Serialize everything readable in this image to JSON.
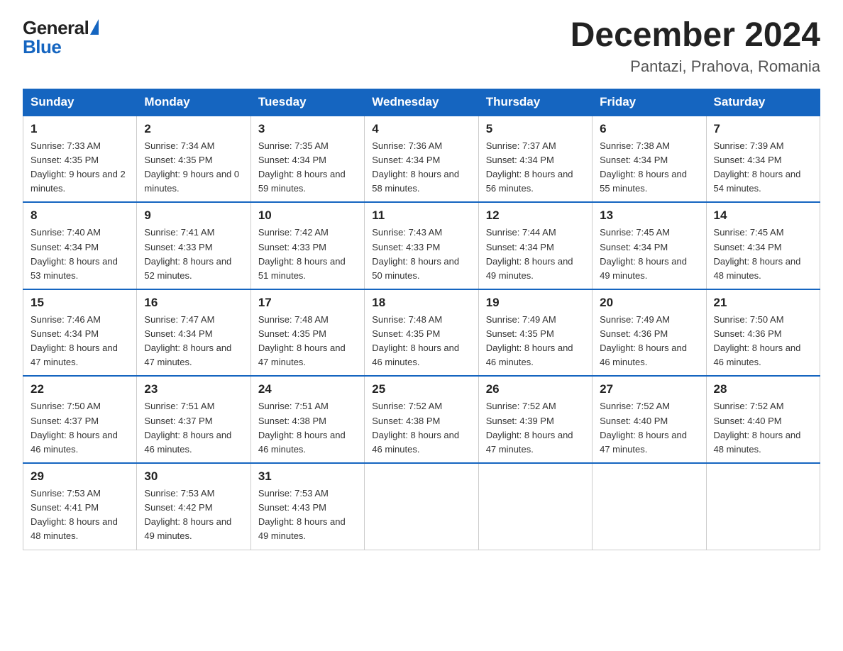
{
  "logo": {
    "general": "General",
    "blue": "Blue"
  },
  "header": {
    "month_year": "December 2024",
    "location": "Pantazi, Prahova, Romania"
  },
  "days_of_week": [
    "Sunday",
    "Monday",
    "Tuesday",
    "Wednesday",
    "Thursday",
    "Friday",
    "Saturday"
  ],
  "weeks": [
    [
      {
        "day": "1",
        "sunrise": "7:33 AM",
        "sunset": "4:35 PM",
        "daylight": "9 hours and 2 minutes."
      },
      {
        "day": "2",
        "sunrise": "7:34 AM",
        "sunset": "4:35 PM",
        "daylight": "9 hours and 0 minutes."
      },
      {
        "day": "3",
        "sunrise": "7:35 AM",
        "sunset": "4:34 PM",
        "daylight": "8 hours and 59 minutes."
      },
      {
        "day": "4",
        "sunrise": "7:36 AM",
        "sunset": "4:34 PM",
        "daylight": "8 hours and 58 minutes."
      },
      {
        "day": "5",
        "sunrise": "7:37 AM",
        "sunset": "4:34 PM",
        "daylight": "8 hours and 56 minutes."
      },
      {
        "day": "6",
        "sunrise": "7:38 AM",
        "sunset": "4:34 PM",
        "daylight": "8 hours and 55 minutes."
      },
      {
        "day": "7",
        "sunrise": "7:39 AM",
        "sunset": "4:34 PM",
        "daylight": "8 hours and 54 minutes."
      }
    ],
    [
      {
        "day": "8",
        "sunrise": "7:40 AM",
        "sunset": "4:34 PM",
        "daylight": "8 hours and 53 minutes."
      },
      {
        "day": "9",
        "sunrise": "7:41 AM",
        "sunset": "4:33 PM",
        "daylight": "8 hours and 52 minutes."
      },
      {
        "day": "10",
        "sunrise": "7:42 AM",
        "sunset": "4:33 PM",
        "daylight": "8 hours and 51 minutes."
      },
      {
        "day": "11",
        "sunrise": "7:43 AM",
        "sunset": "4:33 PM",
        "daylight": "8 hours and 50 minutes."
      },
      {
        "day": "12",
        "sunrise": "7:44 AM",
        "sunset": "4:34 PM",
        "daylight": "8 hours and 49 minutes."
      },
      {
        "day": "13",
        "sunrise": "7:45 AM",
        "sunset": "4:34 PM",
        "daylight": "8 hours and 49 minutes."
      },
      {
        "day": "14",
        "sunrise": "7:45 AM",
        "sunset": "4:34 PM",
        "daylight": "8 hours and 48 minutes."
      }
    ],
    [
      {
        "day": "15",
        "sunrise": "7:46 AM",
        "sunset": "4:34 PM",
        "daylight": "8 hours and 47 minutes."
      },
      {
        "day": "16",
        "sunrise": "7:47 AM",
        "sunset": "4:34 PM",
        "daylight": "8 hours and 47 minutes."
      },
      {
        "day": "17",
        "sunrise": "7:48 AM",
        "sunset": "4:35 PM",
        "daylight": "8 hours and 47 minutes."
      },
      {
        "day": "18",
        "sunrise": "7:48 AM",
        "sunset": "4:35 PM",
        "daylight": "8 hours and 46 minutes."
      },
      {
        "day": "19",
        "sunrise": "7:49 AM",
        "sunset": "4:35 PM",
        "daylight": "8 hours and 46 minutes."
      },
      {
        "day": "20",
        "sunrise": "7:49 AM",
        "sunset": "4:36 PM",
        "daylight": "8 hours and 46 minutes."
      },
      {
        "day": "21",
        "sunrise": "7:50 AM",
        "sunset": "4:36 PM",
        "daylight": "8 hours and 46 minutes."
      }
    ],
    [
      {
        "day": "22",
        "sunrise": "7:50 AM",
        "sunset": "4:37 PM",
        "daylight": "8 hours and 46 minutes."
      },
      {
        "day": "23",
        "sunrise": "7:51 AM",
        "sunset": "4:37 PM",
        "daylight": "8 hours and 46 minutes."
      },
      {
        "day": "24",
        "sunrise": "7:51 AM",
        "sunset": "4:38 PM",
        "daylight": "8 hours and 46 minutes."
      },
      {
        "day": "25",
        "sunrise": "7:52 AM",
        "sunset": "4:38 PM",
        "daylight": "8 hours and 46 minutes."
      },
      {
        "day": "26",
        "sunrise": "7:52 AM",
        "sunset": "4:39 PM",
        "daylight": "8 hours and 47 minutes."
      },
      {
        "day": "27",
        "sunrise": "7:52 AM",
        "sunset": "4:40 PM",
        "daylight": "8 hours and 47 minutes."
      },
      {
        "day": "28",
        "sunrise": "7:52 AM",
        "sunset": "4:40 PM",
        "daylight": "8 hours and 48 minutes."
      }
    ],
    [
      {
        "day": "29",
        "sunrise": "7:53 AM",
        "sunset": "4:41 PM",
        "daylight": "8 hours and 48 minutes."
      },
      {
        "day": "30",
        "sunrise": "7:53 AM",
        "sunset": "4:42 PM",
        "daylight": "8 hours and 49 minutes."
      },
      {
        "day": "31",
        "sunrise": "7:53 AM",
        "sunset": "4:43 PM",
        "daylight": "8 hours and 49 minutes."
      },
      null,
      null,
      null,
      null
    ]
  ]
}
